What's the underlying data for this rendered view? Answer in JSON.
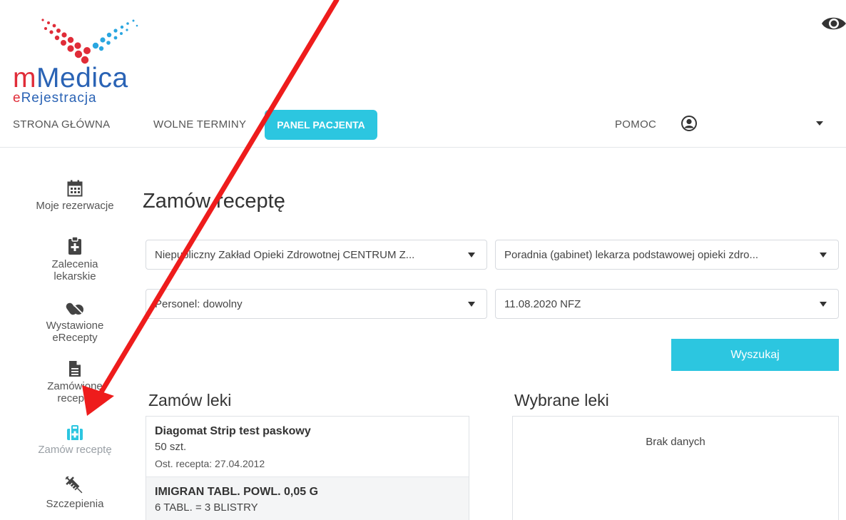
{
  "logo": {
    "brand_m": "m",
    "brand_rest": "Medica",
    "sub_e": "e",
    "sub_rest": "Rejestracja"
  },
  "nav": {
    "items": [
      "STRONA GŁÓWNA",
      "WOLNE TERMINY"
    ],
    "active": "PANEL PACJENTA",
    "help": "POMOC"
  },
  "sidebar": {
    "reservations": [
      "Moje rezerwacje"
    ],
    "recommendations": [
      "Zalecenia",
      "lekarskie"
    ],
    "issued": [
      "Wystawione",
      "eRecepty"
    ],
    "ordered": [
      "Zamówione",
      "recepty"
    ],
    "order": [
      "Zamów receptę"
    ],
    "vaccines": [
      "Szczepienia"
    ]
  },
  "main": {
    "title": "Zamów receptę",
    "facility": "Niepubliczny Zakład Opieki Zdrowotnej CENTRUM Z...",
    "clinic": "Poradnia (gabinet) lekarza podstawowej opieki zdro...",
    "staff": "Personel: dowolny",
    "date": "11.08.2020 NFZ",
    "search_label": "Wyszukaj"
  },
  "order_meds": {
    "title": "Zamów leki",
    "items": [
      {
        "name": "Diagomat Strip test paskowy",
        "qty": "50 szt.",
        "last": "Ost. recepta: 27.04.2012"
      },
      {
        "name": "IMIGRAN TABL. POWL. 0,05 G",
        "qty": "6 TABL. = 3 BLISTRY",
        "last": ""
      }
    ]
  },
  "chosen": {
    "title": "Wybrane leki",
    "empty": "Brak danych"
  },
  "colors": {
    "accent": "#2cc6e0",
    "brand_blue": "#2a63b5",
    "brand_red": "#e02c38",
    "arrow": "#ee1c1c"
  },
  "icons": {
    "logo": "heart-dots-logo",
    "eye": "eye-icon",
    "user": "user-circle-icon",
    "calendar": "calendar-icon",
    "clipboard": "clipboard-plus-icon",
    "pills": "pills-icon",
    "document": "document-icon",
    "medkit": "medkit-icon",
    "syringe": "syringe-icon"
  }
}
